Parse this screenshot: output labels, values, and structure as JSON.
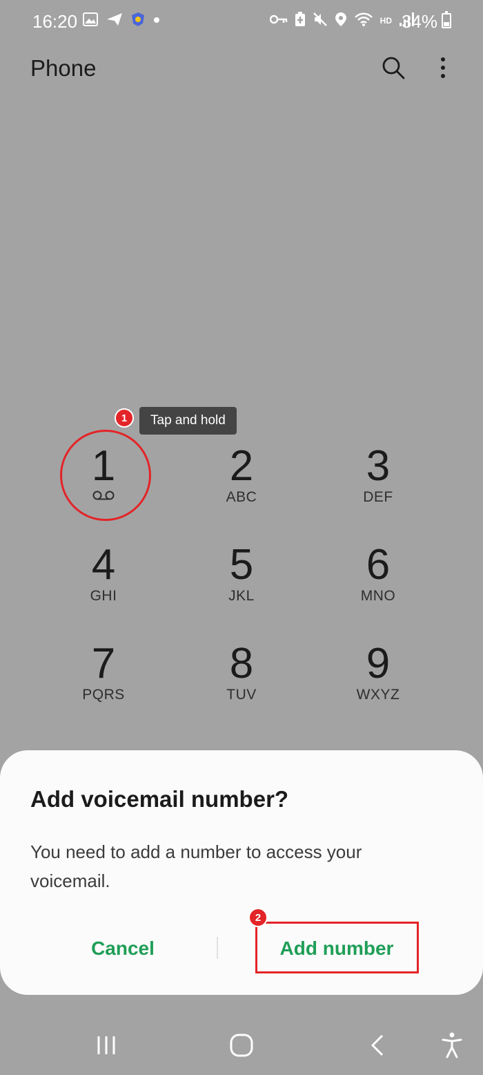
{
  "status_bar": {
    "time": "16:20",
    "battery": "34%",
    "network_label": "HD",
    "left_icons": [
      "gallery-icon",
      "send-icon",
      "shield-icon",
      "dot-icon"
    ],
    "right_icons": [
      "key-icon",
      "battery-saver-icon",
      "mute-icon",
      "location-icon",
      "wifi-icon",
      "signal-icon"
    ]
  },
  "header": {
    "title": "Phone",
    "icons": [
      "search-icon",
      "more-options-icon"
    ]
  },
  "dialpad": {
    "keys": [
      {
        "digit": "1",
        "letters": "",
        "icon": "voicemail-icon"
      },
      {
        "digit": "2",
        "letters": "ABC"
      },
      {
        "digit": "3",
        "letters": "DEF"
      },
      {
        "digit": "4",
        "letters": "GHI"
      },
      {
        "digit": "5",
        "letters": "JKL"
      },
      {
        "digit": "6",
        "letters": "MNO"
      },
      {
        "digit": "7",
        "letters": "PQRS"
      },
      {
        "digit": "8",
        "letters": "TUV"
      },
      {
        "digit": "9",
        "letters": "WXYZ"
      }
    ]
  },
  "annotations": {
    "step1_badge": "1",
    "step1_tooltip": "Tap and hold",
    "step2_badge": "2",
    "highlight_color": "#e32428"
  },
  "dialog": {
    "title": "Add voicemail number?",
    "message": "You need to add a number to access your voicemail.",
    "cancel_label": "Cancel",
    "add_label": "Add number",
    "button_color": "#1f9e57"
  },
  "nav_bar": {
    "icons": [
      "recent-apps-icon",
      "home-icon",
      "back-icon",
      "accessibility-icon"
    ]
  },
  "colors": {
    "scrim_background": "#a3a3a3",
    "dialog_background": "#fbfbfb"
  }
}
